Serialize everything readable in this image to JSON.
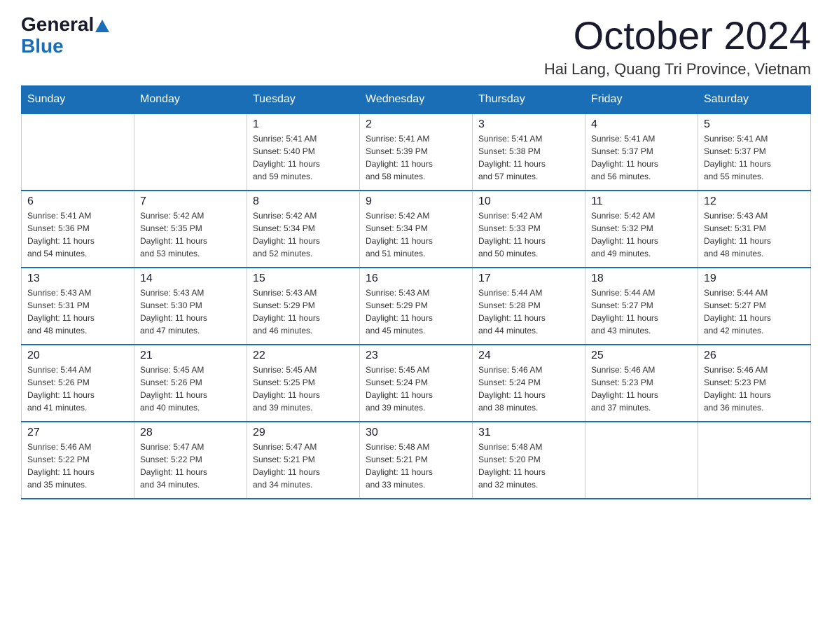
{
  "header": {
    "logo": {
      "general": "General",
      "blue": "Blue"
    },
    "title": "October 2024",
    "location": "Hai Lang, Quang Tri Province, Vietnam"
  },
  "calendar": {
    "days_of_week": [
      "Sunday",
      "Monday",
      "Tuesday",
      "Wednesday",
      "Thursday",
      "Friday",
      "Saturday"
    ],
    "weeks": [
      [
        {
          "day": "",
          "info": ""
        },
        {
          "day": "",
          "info": ""
        },
        {
          "day": "1",
          "info": "Sunrise: 5:41 AM\nSunset: 5:40 PM\nDaylight: 11 hours\nand 59 minutes."
        },
        {
          "day": "2",
          "info": "Sunrise: 5:41 AM\nSunset: 5:39 PM\nDaylight: 11 hours\nand 58 minutes."
        },
        {
          "day": "3",
          "info": "Sunrise: 5:41 AM\nSunset: 5:38 PM\nDaylight: 11 hours\nand 57 minutes."
        },
        {
          "day": "4",
          "info": "Sunrise: 5:41 AM\nSunset: 5:37 PM\nDaylight: 11 hours\nand 56 minutes."
        },
        {
          "day": "5",
          "info": "Sunrise: 5:41 AM\nSunset: 5:37 PM\nDaylight: 11 hours\nand 55 minutes."
        }
      ],
      [
        {
          "day": "6",
          "info": "Sunrise: 5:41 AM\nSunset: 5:36 PM\nDaylight: 11 hours\nand 54 minutes."
        },
        {
          "day": "7",
          "info": "Sunrise: 5:42 AM\nSunset: 5:35 PM\nDaylight: 11 hours\nand 53 minutes."
        },
        {
          "day": "8",
          "info": "Sunrise: 5:42 AM\nSunset: 5:34 PM\nDaylight: 11 hours\nand 52 minutes."
        },
        {
          "day": "9",
          "info": "Sunrise: 5:42 AM\nSunset: 5:34 PM\nDaylight: 11 hours\nand 51 minutes."
        },
        {
          "day": "10",
          "info": "Sunrise: 5:42 AM\nSunset: 5:33 PM\nDaylight: 11 hours\nand 50 minutes."
        },
        {
          "day": "11",
          "info": "Sunrise: 5:42 AM\nSunset: 5:32 PM\nDaylight: 11 hours\nand 49 minutes."
        },
        {
          "day": "12",
          "info": "Sunrise: 5:43 AM\nSunset: 5:31 PM\nDaylight: 11 hours\nand 48 minutes."
        }
      ],
      [
        {
          "day": "13",
          "info": "Sunrise: 5:43 AM\nSunset: 5:31 PM\nDaylight: 11 hours\nand 48 minutes."
        },
        {
          "day": "14",
          "info": "Sunrise: 5:43 AM\nSunset: 5:30 PM\nDaylight: 11 hours\nand 47 minutes."
        },
        {
          "day": "15",
          "info": "Sunrise: 5:43 AM\nSunset: 5:29 PM\nDaylight: 11 hours\nand 46 minutes."
        },
        {
          "day": "16",
          "info": "Sunrise: 5:43 AM\nSunset: 5:29 PM\nDaylight: 11 hours\nand 45 minutes."
        },
        {
          "day": "17",
          "info": "Sunrise: 5:44 AM\nSunset: 5:28 PM\nDaylight: 11 hours\nand 44 minutes."
        },
        {
          "day": "18",
          "info": "Sunrise: 5:44 AM\nSunset: 5:27 PM\nDaylight: 11 hours\nand 43 minutes."
        },
        {
          "day": "19",
          "info": "Sunrise: 5:44 AM\nSunset: 5:27 PM\nDaylight: 11 hours\nand 42 minutes."
        }
      ],
      [
        {
          "day": "20",
          "info": "Sunrise: 5:44 AM\nSunset: 5:26 PM\nDaylight: 11 hours\nand 41 minutes."
        },
        {
          "day": "21",
          "info": "Sunrise: 5:45 AM\nSunset: 5:26 PM\nDaylight: 11 hours\nand 40 minutes."
        },
        {
          "day": "22",
          "info": "Sunrise: 5:45 AM\nSunset: 5:25 PM\nDaylight: 11 hours\nand 39 minutes."
        },
        {
          "day": "23",
          "info": "Sunrise: 5:45 AM\nSunset: 5:24 PM\nDaylight: 11 hours\nand 39 minutes."
        },
        {
          "day": "24",
          "info": "Sunrise: 5:46 AM\nSunset: 5:24 PM\nDaylight: 11 hours\nand 38 minutes."
        },
        {
          "day": "25",
          "info": "Sunrise: 5:46 AM\nSunset: 5:23 PM\nDaylight: 11 hours\nand 37 minutes."
        },
        {
          "day": "26",
          "info": "Sunrise: 5:46 AM\nSunset: 5:23 PM\nDaylight: 11 hours\nand 36 minutes."
        }
      ],
      [
        {
          "day": "27",
          "info": "Sunrise: 5:46 AM\nSunset: 5:22 PM\nDaylight: 11 hours\nand 35 minutes."
        },
        {
          "day": "28",
          "info": "Sunrise: 5:47 AM\nSunset: 5:22 PM\nDaylight: 11 hours\nand 34 minutes."
        },
        {
          "day": "29",
          "info": "Sunrise: 5:47 AM\nSunset: 5:21 PM\nDaylight: 11 hours\nand 34 minutes."
        },
        {
          "day": "30",
          "info": "Sunrise: 5:48 AM\nSunset: 5:21 PM\nDaylight: 11 hours\nand 33 minutes."
        },
        {
          "day": "31",
          "info": "Sunrise: 5:48 AM\nSunset: 5:20 PM\nDaylight: 11 hours\nand 32 minutes."
        },
        {
          "day": "",
          "info": ""
        },
        {
          "day": "",
          "info": ""
        }
      ]
    ]
  }
}
